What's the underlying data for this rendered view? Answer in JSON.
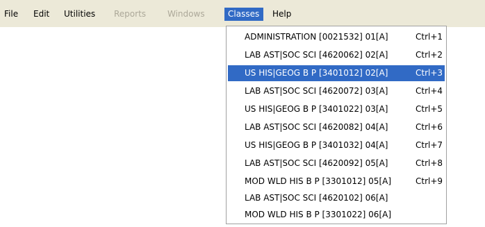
{
  "menubar": {
    "items": [
      {
        "label": "File",
        "state": "normal"
      },
      {
        "label": "Edit",
        "state": "normal"
      },
      {
        "label": "Utilities",
        "state": "normal"
      },
      {
        "label": "Reports",
        "state": "disabled"
      },
      {
        "label": "Windows",
        "state": "disabled"
      },
      {
        "label": "Classes",
        "state": "active"
      },
      {
        "label": "Help",
        "state": "normal"
      }
    ]
  },
  "classes_menu": {
    "items": [
      {
        "label": "ADMINISTRATION [0021532]  01[A]",
        "shortcut": "Ctrl+1"
      },
      {
        "label": "LAB AST|SOC SCI [4620062]  02[A]",
        "shortcut": "Ctrl+2"
      },
      {
        "label": "US HIS|GEOG B P [3401012]  02[A]",
        "shortcut": "Ctrl+3",
        "selected": true
      },
      {
        "label": "LAB AST|SOC SCI [4620072]  03[A]",
        "shortcut": "Ctrl+4"
      },
      {
        "label": "US HIS|GEOG B P [3401022]  03[A]",
        "shortcut": "Ctrl+5"
      },
      {
        "label": "LAB AST|SOC SCI [4620082]  04[A]",
        "shortcut": "Ctrl+6"
      },
      {
        "label": "US HIS|GEOG B P [3401032]  04[A]",
        "shortcut": "Ctrl+7"
      },
      {
        "label": "LAB AST|SOC SCI [4620092]  05[A]",
        "shortcut": "Ctrl+8"
      },
      {
        "label": "MOD WLD HIS B P [3301012]  05[A]",
        "shortcut": "Ctrl+9"
      },
      {
        "label": "LAB AST|SOC SCI [4620102]  06[A]",
        "shortcut": ""
      },
      {
        "label": "MOD WLD HIS B P [3301022]  06[A]",
        "shortcut": ""
      }
    ]
  },
  "colors": {
    "menubar_background": "#ece9d8",
    "highlight": "#316ac5",
    "highlight_text": "#ffffff",
    "disabled_text": "#aca899"
  }
}
